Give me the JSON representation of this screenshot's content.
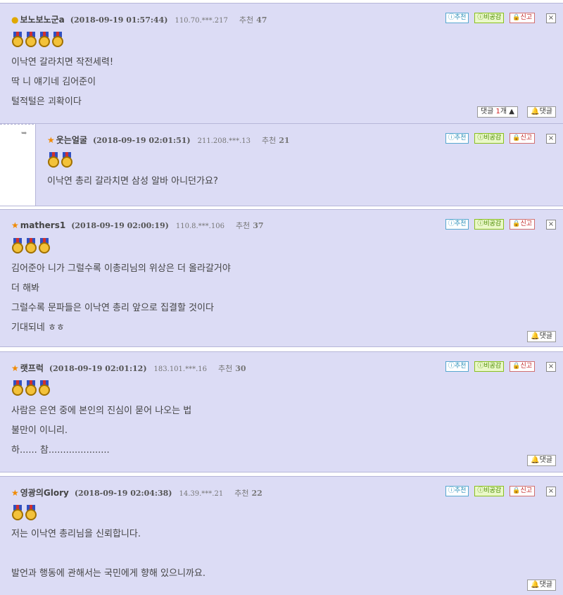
{
  "buttons": {
    "recommend": "ⓘ추천",
    "nonrecommend": "ⓘ비공감",
    "report": "신고",
    "close": "×",
    "reply": "댓글",
    "reply_count_prefix": "댓글 ",
    "reply_count_suffix": "개 ▲"
  },
  "comments": [
    {
      "nick": "보노보노군a",
      "icon": "medal-head-icon",
      "date": "(2018-09-19 01:57:44)",
      "ip": "110.70.***.217",
      "rec_label": "추천",
      "rec": "47",
      "medals": 4,
      "lines": [
        "이낙연 갈라치면 작전세력!",
        "딱 니 얘기네 김어준이",
        "털적털은 괴확이다"
      ],
      "reply_count": "1"
    },
    {
      "nick": "웃는얼굴",
      "icon": "star-icon",
      "date": "(2018-09-19 02:01:51)",
      "ip": "211.208.***.13",
      "rec_label": "추천",
      "rec": "21",
      "medals": 2,
      "lines": [
        "이낙연 총리 갈라치면 삼성 알바 아니던가요?"
      ]
    },
    {
      "nick": "mathers1",
      "icon": "star-icon",
      "date": "(2018-09-19 02:00:19)",
      "ip": "110.8.***.106",
      "rec_label": "추천",
      "rec": "37",
      "medals": 3,
      "lines": [
        "김어준아 니가 그럴수록 이총리님의 위상은 더 올라갈거야",
        "더 해봐",
        "그럴수록 문파들은 이낙연 총리 앞으로 집결할 것이다",
        "기대되네 ㅎㅎ"
      ]
    },
    {
      "nick": "랫프럭",
      "icon": "star-icon",
      "date": "(2018-09-19 02:01:12)",
      "ip": "183.101.***.16",
      "rec_label": "추천",
      "rec": "30",
      "medals": 3,
      "lines": [
        "사람은 은연 중에 본인의 진심이 묻어 나오는 법",
        "불만이 이니리.",
        "하...... 참....................."
      ]
    },
    {
      "nick": "영광의Glory",
      "icon": "star-icon",
      "date": "(2018-09-19 02:04:38)",
      "ip": "14.39.***.21",
      "rec_label": "추천",
      "rec": "22",
      "medals": 2,
      "lines": [
        "저는 이낙연 총리님을 신뢰합니다.",
        "",
        "발언과 행동에 관해서는 국민에게 향해 있으니까요."
      ]
    }
  ]
}
